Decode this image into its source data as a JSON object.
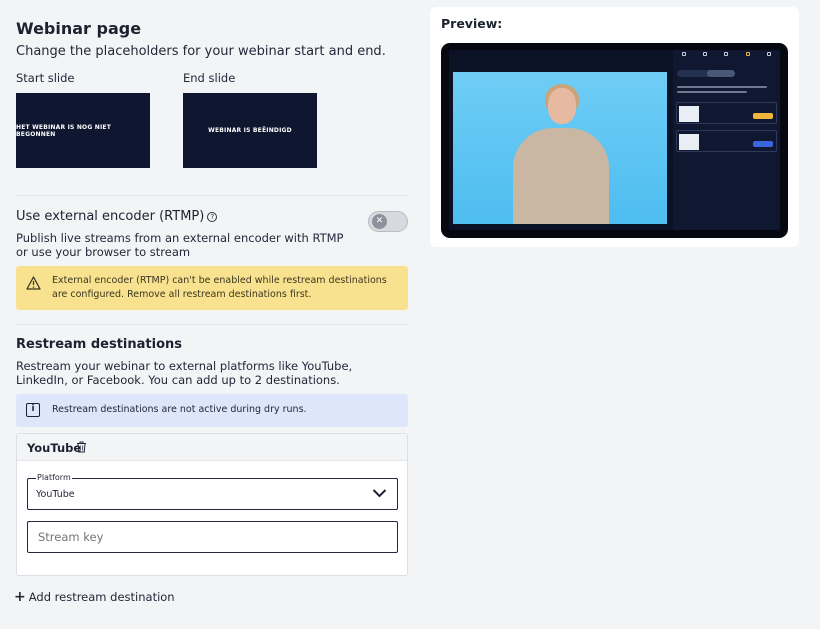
{
  "page": {
    "title": "Webinar page",
    "subtitle": "Change the placeholders for your webinar start and end."
  },
  "slides": {
    "start_label": "Start slide",
    "start_text": "HET WEBINAR IS NOG NIET BEGONNEN",
    "end_label": "End slide",
    "end_text": "WEBINAR IS BEËINDIGD"
  },
  "encoder": {
    "title": "Use external encoder (RTMP)",
    "help_icon": "question-circle-icon",
    "description": "Publish live streams from an external encoder with RTMP or use your browser to stream",
    "toggle_state": "off",
    "warning_icon": "warning-triangle-icon",
    "warning": "External encoder (RTMP) can't be enabled while restream destinations are configured. Remove all restream destinations first."
  },
  "restream": {
    "title": "Restream destinations",
    "description": "Restream your webinar to external platforms like YouTube, LinkedIn, or Facebook. You can add up to 2 destinations.",
    "info_icon": "info-icon",
    "info": "Restream destinations are not active during dry runs.",
    "destination": {
      "name": "YouTube",
      "delete_icon": "trash-icon",
      "platform_label": "Platform",
      "platform_value": "YouTube",
      "stream_key_placeholder": "Stream key"
    },
    "add_label": "Add restream destination"
  },
  "preview": {
    "label": "Preview:"
  },
  "colors": {
    "slide_bg": "#0e1630",
    "warning_bg": "#f8e28f",
    "info_bg": "#dde6fb",
    "page_bg": "#f3f4f6"
  }
}
